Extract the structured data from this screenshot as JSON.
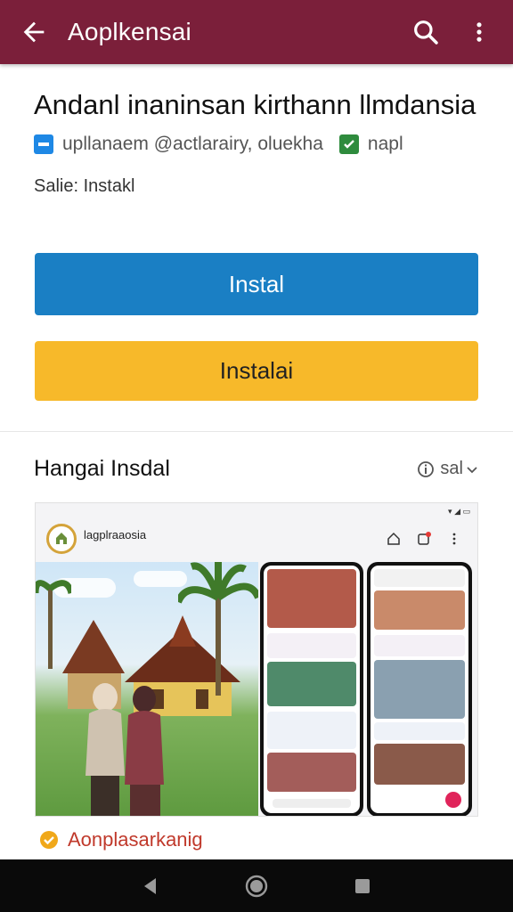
{
  "appbar": {
    "title": "Aoplkensai",
    "back_icon": "arrow-back-icon",
    "search_icon": "search-icon",
    "more_icon": "more-vert-icon",
    "color": "#7b1f3a"
  },
  "app": {
    "name": "Andanl inaninsan kirthann llmdansia",
    "developer": "upllanaem @actlarairy, oluekha",
    "tag": "napl",
    "status": "Salie: Instakl"
  },
  "buttons": {
    "primary_label": "Instal",
    "secondary_label": "Instalai",
    "primary_color": "#1a7fc4",
    "secondary_color": "#f7b92a"
  },
  "section": {
    "title": "Hangai Insdal",
    "action": "sal"
  },
  "preview": {
    "app_label": "lagplraaosia",
    "status_bar": "▾ ◢ ▭"
  },
  "caption": {
    "text": "Aonplasarkanig"
  }
}
